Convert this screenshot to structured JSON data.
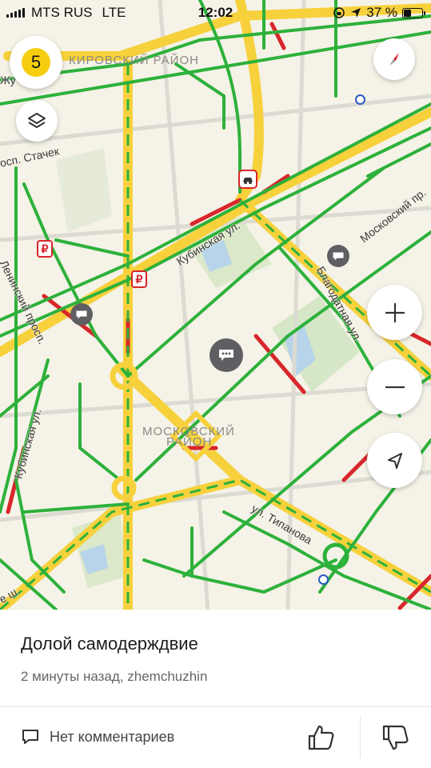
{
  "status_bar": {
    "carrier": "MTS RUS",
    "network": "LTE",
    "time": "12:02",
    "battery": "37 %",
    "battery_level": 0.37
  },
  "map": {
    "traffic_score": "5",
    "districts": [
      "КИРОВСКИЙ РАЙОН",
      "МОСКОВСКИЙ",
      "РАЙОН"
    ],
    "streets": {
      "stachek": "осп. Стачек",
      "kubinskaya_top": "Кубинская ул.",
      "moskovsky": "Московский пр.",
      "blagodatnaya": "Благодатная ул.",
      "leninsky": "Ленинский просп.",
      "kubinskaya_left": "Кубинская ул.",
      "tipanova": "ул. Типанова",
      "zh": "Жу",
      "sh": "е ш."
    },
    "icons": {
      "traffic": "traffic-score-icon",
      "layers": "layers-icon",
      "compass": "compass-icon",
      "zoom_in": "plus-icon",
      "zoom_out": "minus-icon",
      "locate": "location-arrow-icon",
      "chat": "chat-bubble-icon",
      "ruble": "ruble-icon",
      "metro": "metro-icon",
      "accident": "accident-icon"
    },
    "colors": {
      "jam": "#d8262b",
      "slow": "#f7d13c",
      "free": "#2db13b",
      "background": "#f5f2e7"
    }
  },
  "card": {
    "title": "Долой самодерждвие",
    "meta": "2 минуты назад, zhemchuzhin",
    "comments": "Нет комментариев",
    "ruble_symbol": "₽"
  }
}
